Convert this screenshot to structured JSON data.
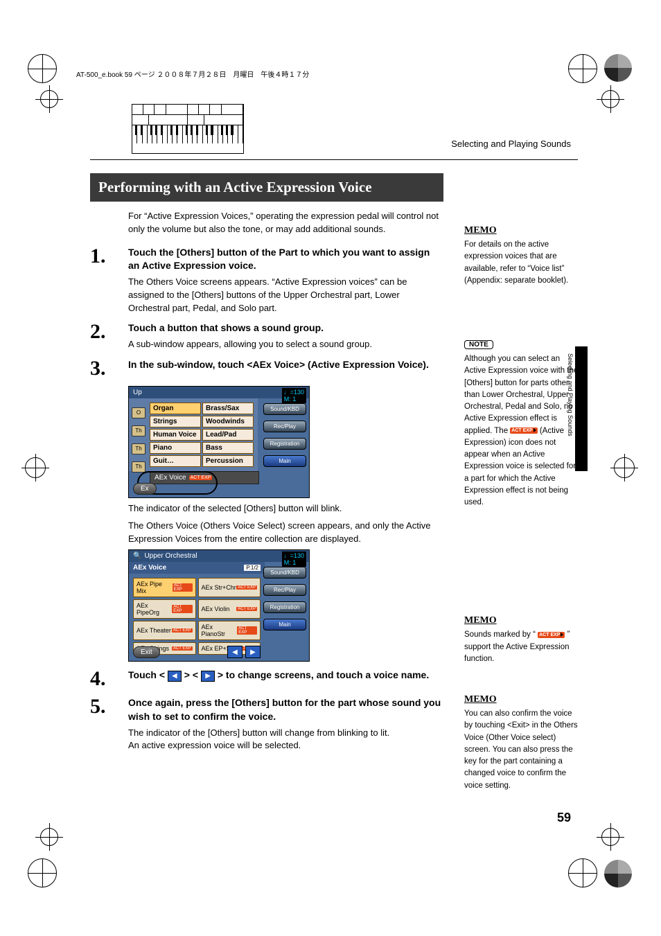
{
  "header_line": "AT-500_e.book  59 ページ  ２００８年７月２８日　月曜日　午後４時１７分",
  "running_head": "Selecting and Playing Sounds",
  "vtab_text": "Selecting and Playing Sounds",
  "page_number": "59",
  "section_title": "Performing with an Active Expression Voice",
  "intro": "For “Active Expression Voices,” operating the expression pedal will control not only the volume but also the tone, or may add additional sounds.",
  "steps": {
    "s1": {
      "num": "1.",
      "head": "Touch the [Others] button of the Part to which you want to assign an Active Expression voice.",
      "desc": "The Others Voice screens appears. “Active Expression voices” can be assigned to the [Others] buttons of the Upper Orchestral part, Lower Orchestral part, Pedal, and Solo part."
    },
    "s2": {
      "num": "2.",
      "head": "Touch a button that shows a sound group.",
      "desc": "A sub-window appears, allowing you to select a sound group."
    },
    "s3": {
      "num": "3.",
      "head": "In the sub-window, touch <AEx Voice> (Active Expression Voice)."
    },
    "s4": {
      "num": "4.",
      "head_pre": "Touch < ",
      "head_mid": " > < ",
      "head_post": " > to change screens, and touch a voice name."
    },
    "s5": {
      "num": "5.",
      "head": "Once again, press the [Others] button for the part whose sound you wish to set to confirm the voice.",
      "desc1": "The indicator of the [Others] button will change from blinking to lit.",
      "desc2": "An active expression voice will be selected."
    }
  },
  "caption1": "The indicator of the selected [Others] button will blink.",
  "caption2": "The Others Voice (Others Voice Select) screen appears, and only the Active Expression Voices from the entire collection are displayed.",
  "shotA": {
    "title_prefix": "Up",
    "tempo": "♩=130",
    "meter": "M:   1",
    "left_pills": [
      "O",
      "Th",
      "Th",
      "Th"
    ],
    "cells": [
      {
        "t": "Organ",
        "hl": true
      },
      {
        "t": "Brass/Sax",
        "hl": false
      },
      {
        "t": "Strings",
        "hl": false
      },
      {
        "t": "Woodwinds",
        "hl": false
      },
      {
        "t": "Human Voice",
        "hl": false
      },
      {
        "t": "Lead/Pad",
        "hl": false
      },
      {
        "t": "Piano",
        "hl": false
      },
      {
        "t": "Bass",
        "hl": false
      },
      {
        "t": "Guit…",
        "hl": false
      },
      {
        "t": "Percussion",
        "hl": false
      }
    ],
    "aex_label": "AEx Voice",
    "exit": "Ex",
    "side": [
      "Sound/KBD",
      "Rec/Play",
      "Registration",
      "Main"
    ]
  },
  "shotB": {
    "title": "Upper Orchestral",
    "header": "AEx Voice",
    "page": "P.1/2",
    "tempo": "♩=130",
    "meter": "M:   1",
    "voices_left": [
      "AEx Pipe Mix",
      "AEx PipeOrg",
      "AEx Theater",
      "AEx Strings"
    ],
    "voices_right": [
      "AEx Str+Chr",
      "AEx Violin",
      "AEx PianoStr",
      "AEx EP+Str"
    ],
    "exit": "Exit",
    "side": [
      "Sound/KBD",
      "Rec/Play",
      "Registration",
      "Main"
    ]
  },
  "memo1": {
    "label": "MEMO",
    "text": "For details on the active expression voices that are available, refer to “Voice list” (Appendix: separate booklet)."
  },
  "note1": {
    "label": "NOTE",
    "text_pre": "Although you can select an Active Expression voice with the [Others] button for parts other than Lower Orchestral, Upper Orchestral, Pedal and Solo, no Active Expression effect is applied. The ",
    "text_post": " (Active Expression) icon does not appear when an Active Expression voice is selected for a part for which the Active Expression effect is not being used."
  },
  "memo2": {
    "label": "MEMO",
    "text_pre": "Sounds marked by “",
    "text_post": "” support the Active Expression function."
  },
  "memo3": {
    "label": "MEMO",
    "text": "You can also confirm the voice by touching <Exit> in the Others Voice (Other Voice select) screen. You can also press the key for the part containing a changed voice to confirm the voice setting."
  },
  "act_exp_badge": "ACT EXP"
}
